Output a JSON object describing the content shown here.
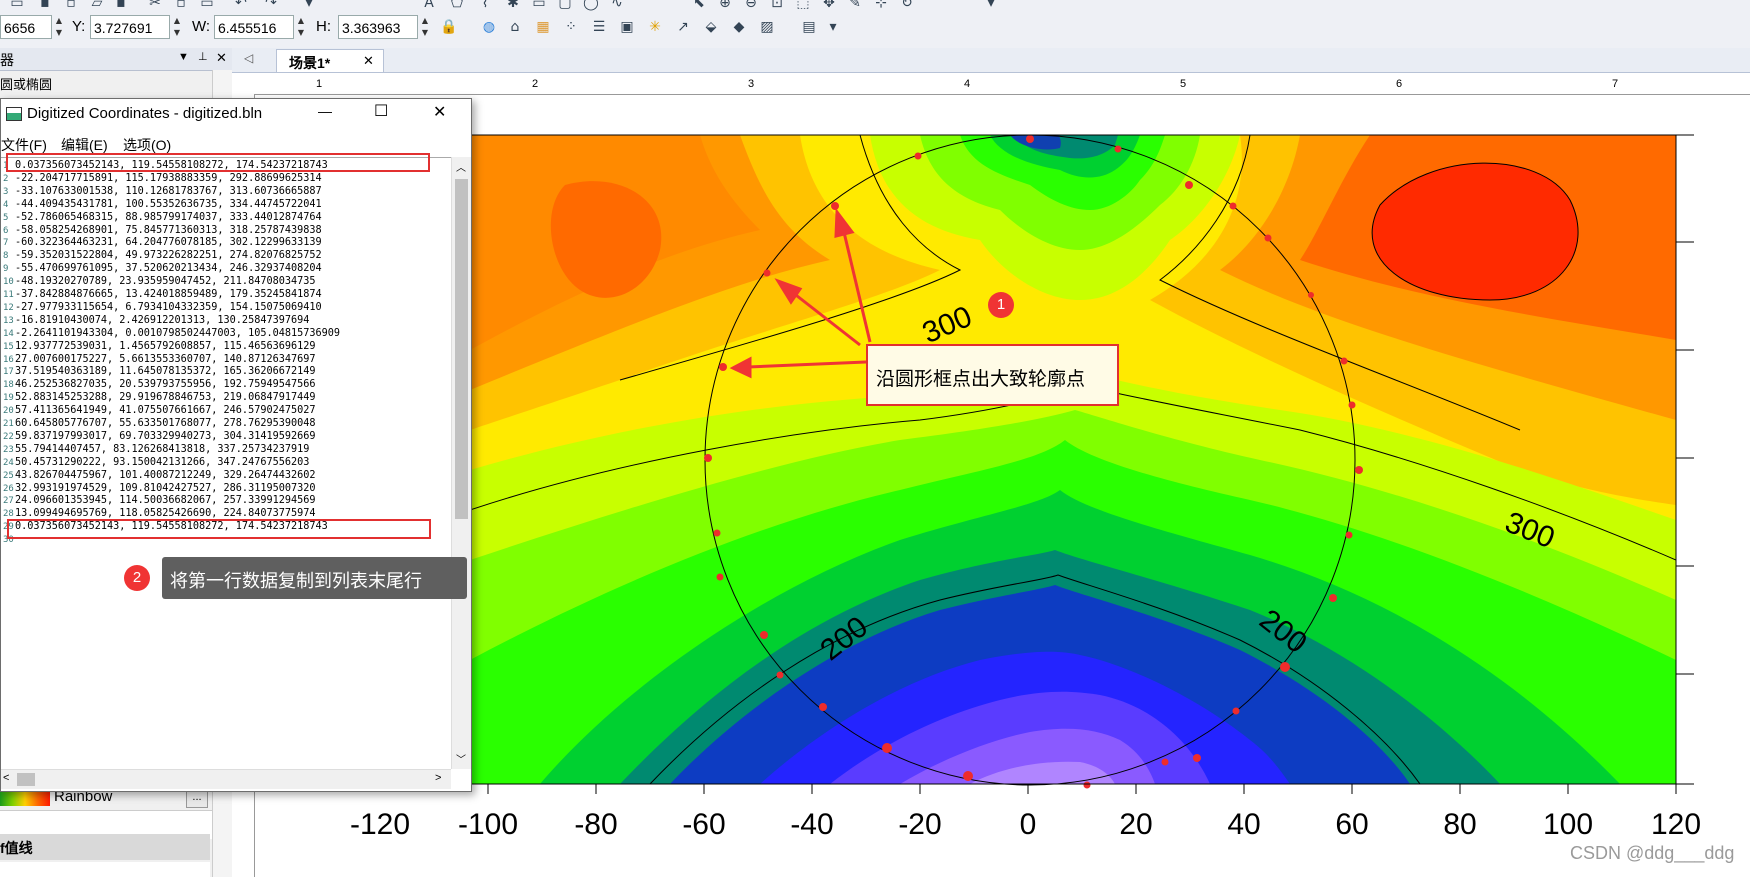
{
  "toolbar": {
    "x_value": "6656",
    "y_label": "Y:",
    "y_value": "3.727691",
    "w_label": "W:",
    "w_value": "6.455516",
    "h_label": "H:",
    "h_value": "3.363963"
  },
  "left_panel": {
    "header_title": "器",
    "header_icons": [
      "▼",
      "📌",
      "✕"
    ],
    "subtitle": "圆或椭圆",
    "colormap_name": "Rainbow",
    "colormap_button": "...",
    "section_label": "f值线"
  },
  "tab": {
    "label": "场景1*",
    "close": "✕",
    "nav": "◁"
  },
  "ruler": {
    "ticks": [
      "1",
      "2",
      "3",
      "4",
      "5",
      "6",
      "7"
    ]
  },
  "digitize_window": {
    "title": "Digitized Coordinates - digitized.bln",
    "menu": [
      "文件(F)",
      "编辑(E)",
      "选项(O)"
    ],
    "minimize": "—",
    "maximize": "☐",
    "close": "✕",
    "lines": [
      "0.037356073452143, 119.54558108272, 174.54237218743",
      "-22.204717715891, 115.17938883359, 292.88699625314",
      "-33.107633001538, 110.12681783767, 313.60736665887",
      "-44.409435431781, 100.55352636735, 334.44745722041",
      "-52.786065468315, 88.985799174037, 333.44012874764",
      "-58.058254268901, 75.845771360313, 318.25787439838",
      "-60.322364463231, 64.204776078185, 302.12299633139",
      "-59.352031522804, 49.973226282251, 274.82076825752",
      "-55.470699761095, 37.520620213434, 246.32937408204",
      "-48.19320270789, 23.935959047452, 211.84708034735",
      "-37.842884876665, 13.424018859489, 179.35245841874",
      "-27.977933115654, 6.7934104332359, 154.15075069410",
      "-16.81910430074, 2.426912201313, 130.25847397694",
      "-2.2641101943304, 0.0010798502447003, 105.04815736909",
      "12.937772539031, 1.4565792608857, 115.46563696129",
      "27.007600175227, 5.6613553360707, 140.87126347697",
      "37.519540363189, 11.645078135372, 165.36206672149",
      "46.252536827035, 20.539793755956, 192.75949547566",
      "52.883145253288, 29.919678846753, 219.06847917449",
      "57.411365641949, 41.075507661667, 246.57902475027",
      "60.645805776707, 55.633501768077, 278.76295390048",
      "59.837197993017, 69.703329940273, 304.31419592669",
      "55.79414407457, 83.126268413818, 337.25734237919",
      "50.45731290222, 93.150042131266, 347.24767556203",
      "43.826704475967, 101.40087212249, 329.26474432602",
      "32.993191974529, 109.81042427527, 286.31195007320",
      "24.096601353945, 114.50036682067, 257.33991294569",
      "13.099494695769, 118.05825426690, 224.84073775974",
      "0.037356073452143, 119.54558108272, 174.54237218743"
    ]
  },
  "annotations": {
    "callout1_num": "1",
    "callout1_text": "沿圆形框点出大致轮廓点",
    "callout2_num": "2",
    "callout2_text": "将第一行数据复制到列表末尾行"
  },
  "plot": {
    "x_ticks": [
      "-120",
      "-100",
      "-80",
      "-60",
      "-40",
      "-20",
      "0",
      "20",
      "40",
      "60",
      "80",
      "100",
      "120"
    ],
    "contour_labels": [
      "300",
      "300",
      "200",
      "200"
    ]
  },
  "watermark": "CSDN @ddg___ddg",
  "colors": {
    "accent_red": "#e23030",
    "selection_blue": "#0078d7"
  }
}
